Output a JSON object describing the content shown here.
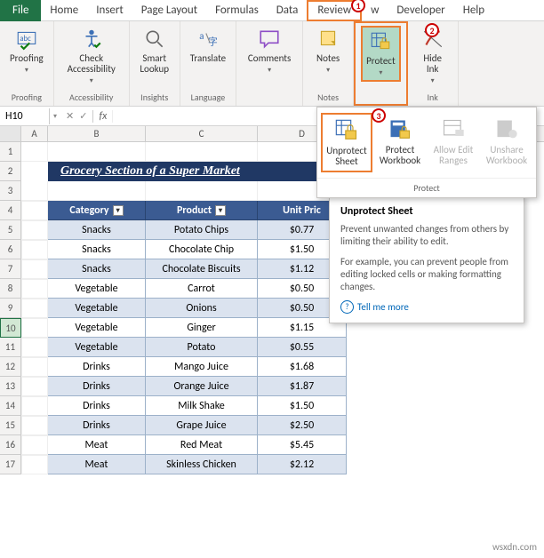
{
  "tabs": {
    "file": "File",
    "home": "Home",
    "insert": "Insert",
    "pagelayout": "Page Layout",
    "formulas": "Formulas",
    "data": "Data",
    "review": "Review",
    "view": "w",
    "developer": "Developer",
    "help": "Help"
  },
  "ribbon": {
    "proofing": {
      "btn": "Proofing",
      "label": "Proofing"
    },
    "accessibility": {
      "btn": "Check\nAccessibility",
      "label": "Accessibility"
    },
    "insights": {
      "btn": "Smart\nLookup",
      "label": "Insights"
    },
    "language": {
      "btn": "Translate",
      "label": "Language"
    },
    "comments": {
      "btn": "Comments",
      "label": ""
    },
    "notes": {
      "btn": "Notes",
      "label": "Notes"
    },
    "protect": {
      "btn": "Protect",
      "label": ""
    },
    "ink": {
      "btn": "Hide\nInk",
      "label": "Ink"
    }
  },
  "protect_panel": {
    "unprotect": "Unprotect\nSheet",
    "workbook": "Protect\nWorkbook",
    "ranges": "Allow Edit\nRanges",
    "unshare": "Unshare\nWorkbook",
    "label": "Protect"
  },
  "tooltip": {
    "title": "Unprotect Sheet",
    "p1": "Prevent unwanted changes from others by limiting their ability to edit.",
    "p2": "For example, you can prevent people from editing locked cells or making formatting changes.",
    "more": "Tell me more"
  },
  "namebox": "H10",
  "cols": [
    "A",
    "B",
    "C",
    "D"
  ],
  "title": "Grocery Section of  a Super Market",
  "headers": [
    "Category",
    "Product",
    "Unit Pric"
  ],
  "rows": [
    {
      "cat": "Snacks",
      "prod": "Potato Chips",
      "price": "$0.77"
    },
    {
      "cat": "Snacks",
      "prod": "Chocolate Chip",
      "price": "$1.50"
    },
    {
      "cat": "Snacks",
      "prod": "Chocolate Biscuits",
      "price": "$1.12"
    },
    {
      "cat": "Vegetable",
      "prod": "Carrot",
      "price": "$0.50"
    },
    {
      "cat": "Vegetable",
      "prod": "Onions",
      "price": "$0.50"
    },
    {
      "cat": "Vegetable",
      "prod": "Ginger",
      "price": "$1.15"
    },
    {
      "cat": "Vegetable",
      "prod": "Potato",
      "price": "$0.55"
    },
    {
      "cat": "Drinks",
      "prod": "Mango Juice",
      "price": "$1.68"
    },
    {
      "cat": "Drinks",
      "prod": "Orange Juice",
      "price": "$1.87"
    },
    {
      "cat": "Drinks",
      "prod": "Milk Shake",
      "price": "$1.50"
    },
    {
      "cat": "Drinks",
      "prod": "Grape Juice",
      "price": "$2.50"
    },
    {
      "cat": "Meat",
      "prod": "Red Meat",
      "price": "$5.45"
    },
    {
      "cat": "Meat",
      "prod": "Skinless Chicken",
      "price": "$2.12"
    }
  ],
  "callouts": {
    "c1": "1",
    "c2": "2",
    "c3": "3"
  },
  "watermark": "wsxdn.com"
}
